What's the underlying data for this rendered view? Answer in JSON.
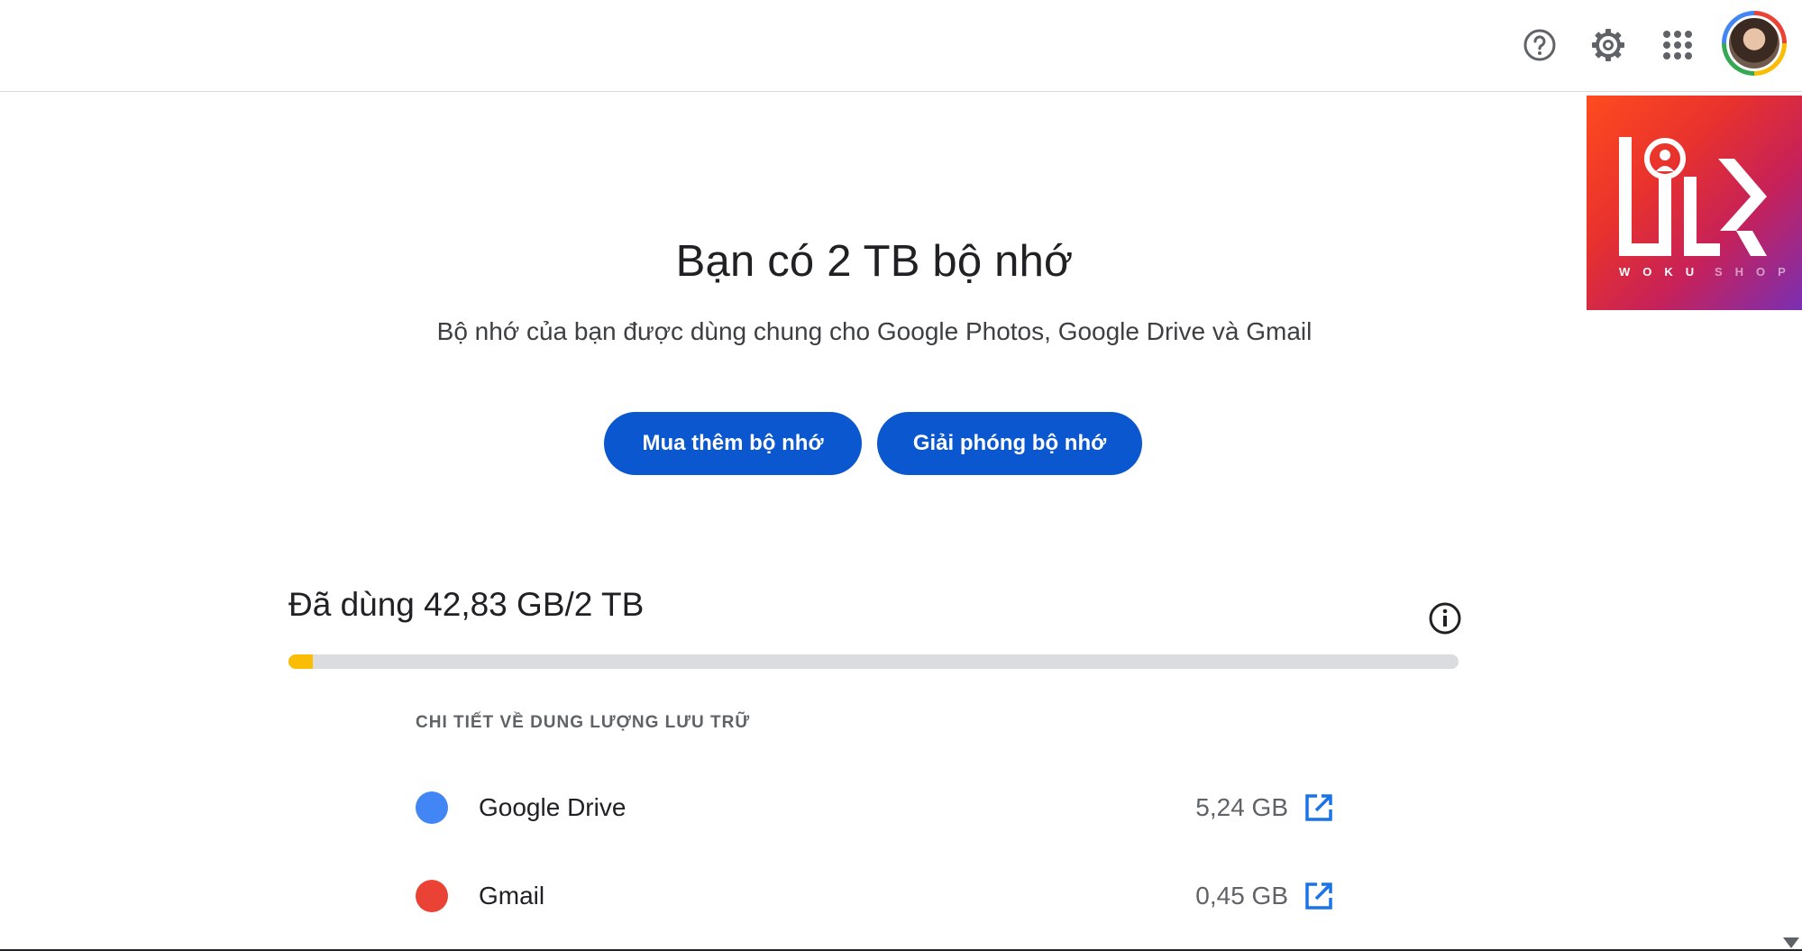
{
  "header": {
    "icons": [
      "help-icon",
      "settings-icon",
      "apps-grid-icon",
      "account-avatar"
    ]
  },
  "watermark": {
    "brand": "WOKUSHOP",
    "letters": [
      "W",
      "O",
      "K",
      "U",
      "S",
      "H",
      "O",
      "P"
    ]
  },
  "main": {
    "title": "Bạn có 2 TB bộ nhớ",
    "subtitle": "Bộ nhớ của bạn được dùng chung cho Google Photos, Google Drive và Gmail",
    "buy_button": "Mua thêm bộ nhớ",
    "free_button": "Giải phóng bộ nhớ"
  },
  "usage": {
    "label": "Đã dùng 42,83 GB/2 TB",
    "used_fraction": 0.021,
    "bar_color": "#fbbc04"
  },
  "details": {
    "heading": "CHI TIẾT VỀ DUNG LƯỢNG LƯU TRỮ",
    "items": [
      {
        "name": "Google Drive",
        "size": "5,24 GB",
        "color": "#4285f4",
        "icon": "open-in-new-icon"
      },
      {
        "name": "Gmail",
        "size": "0,45 GB",
        "color": "#ea4335",
        "icon": "open-in-new-icon"
      }
    ]
  },
  "colors": {
    "primary_button": "#0b57d0",
    "link_icon": "#1a73e8"
  }
}
